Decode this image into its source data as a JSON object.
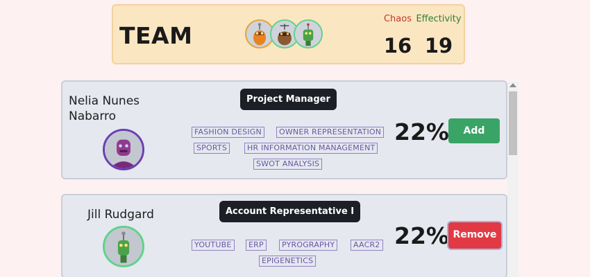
{
  "header": {
    "title": "TEAM",
    "chaos_label": "Chaos",
    "chaos_value": "16",
    "effectivity_label": "Effectivity",
    "effectivity_value": "19",
    "member_avatars": [
      "orange-robot-avatar",
      "brown-robot-avatar",
      "green-robot-avatar"
    ]
  },
  "members": [
    {
      "name": "Nelia Nunes Nabarro",
      "role": "Project Manager",
      "tags": [
        "FASHION DESIGN",
        "OWNER REPRESENTATION",
        "SPORTS",
        "HR INFORMATION MANAGEMENT",
        "SWOT ANALYSIS"
      ],
      "percent": "22%",
      "action": "Add",
      "avatar": "purple-robot-avatar"
    },
    {
      "name": "Jill Rudgard",
      "role": "Account Representative I",
      "tags": [
        "YOUTUBE",
        "ERP",
        "PYROGRAPHY",
        "AACR2",
        "EPIGENETICS"
      ],
      "percent": "22%",
      "action": "Remove",
      "avatar": "green-robot-avatar"
    }
  ],
  "colors": {
    "background": "#fdf1f1",
    "header_bg": "#fbe6c2",
    "chaos": "#c0392b",
    "effectivity": "#2e7d32",
    "add": "#3aa466",
    "remove": "#e23a44",
    "tag": "#6a55a5"
  }
}
